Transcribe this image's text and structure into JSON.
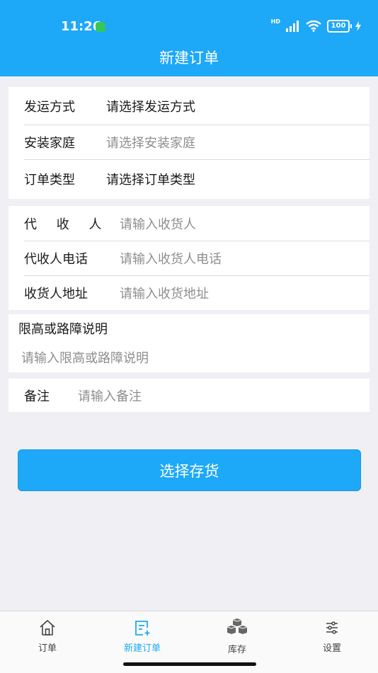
{
  "status_bar": {
    "time": "11:26",
    "battery": "100"
  },
  "header": {
    "title": "新建订单"
  },
  "group1": [
    {
      "label": "发运方式",
      "value": "请选择发运方式"
    },
    {
      "label": "安装家庭",
      "value": "请选择安装家庭"
    },
    {
      "label": "订单类型",
      "value": "请选择订单类型"
    }
  ],
  "group2": [
    {
      "label": "代 收 人",
      "placeholder": "请输入收货人"
    },
    {
      "label": "代收人电话",
      "placeholder": "请输入收货人电话"
    },
    {
      "label": "收货人地址",
      "placeholder": "请输入收货地址"
    }
  ],
  "obstacle": {
    "label": "限高或路障说明",
    "placeholder": "请输入限高或路障说明"
  },
  "remark": {
    "label": "备注",
    "placeholder": "请输入备注"
  },
  "primary_button": {
    "label": "选择存货"
  },
  "tabbar": {
    "items": [
      {
        "label": "订单",
        "icon": "home-icon"
      },
      {
        "label": "新建订单",
        "icon": "new-order-icon",
        "active": true
      },
      {
        "label": "库存",
        "icon": "inventory-boxes-icon"
      },
      {
        "label": "设置",
        "icon": "settings-sliders-icon"
      }
    ]
  },
  "colors": {
    "primary": "#1ea8f8",
    "background": "#efeff4",
    "placeholder": "#8e8e8e"
  }
}
